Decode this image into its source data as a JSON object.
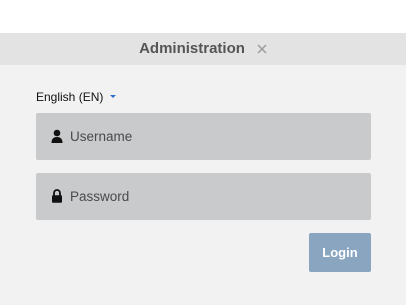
{
  "dialog": {
    "title": "Administration",
    "close_icon": "close-icon"
  },
  "language": {
    "selected": "English (EN)",
    "caret_icon": "chevron-down-icon",
    "caret_color": "#2a6fc9"
  },
  "form": {
    "username": {
      "placeholder": "Username",
      "value": "",
      "icon": "user-icon"
    },
    "password": {
      "placeholder": "Password",
      "value": "",
      "icon": "lock-icon"
    },
    "login_label": "Login"
  },
  "colors": {
    "titlebar": "#e3e3e3",
    "panel": "#f2f2f2",
    "field": "#c9cacc",
    "login_button": "#8aa5c0"
  }
}
